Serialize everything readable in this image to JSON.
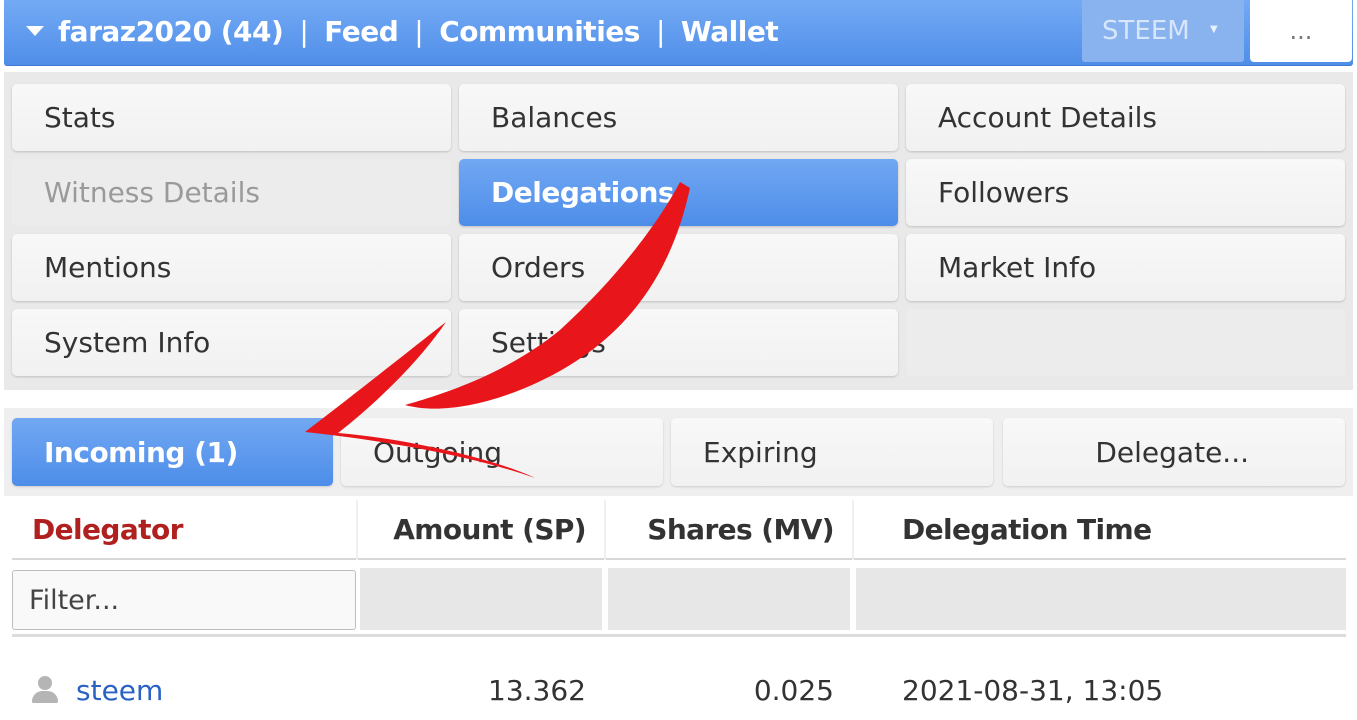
{
  "topbar": {
    "account_label": "faraz2020 (44)",
    "separator": "|",
    "links": [
      "Feed",
      "Communities",
      "Wallet"
    ],
    "chain_select": "STEEM",
    "more_label": "..."
  },
  "menu": {
    "items": [
      {
        "label": "Stats"
      },
      {
        "label": "Balances"
      },
      {
        "label": "Account Details"
      },
      {
        "label": "Witness Details",
        "state": "disabled"
      },
      {
        "label": "Delegations",
        "state": "active"
      },
      {
        "label": "Followers"
      },
      {
        "label": "Mentions"
      },
      {
        "label": "Orders"
      },
      {
        "label": "Market Info"
      },
      {
        "label": "System Info"
      },
      {
        "label": "Settings"
      }
    ]
  },
  "tabs": {
    "items": [
      {
        "label": "Incoming (1)",
        "state": "active"
      },
      {
        "label": "Outgoing"
      },
      {
        "label": "Expiring"
      },
      {
        "label": "Delegate..."
      }
    ]
  },
  "table": {
    "headers": [
      "Delegator",
      "Amount (SP)",
      "Shares (MV)",
      "Delegation Time"
    ],
    "sorted_column": "Delegator",
    "filter_placeholder": "Filter...",
    "rows": [
      {
        "delegator": "steem",
        "amount": "13.362",
        "shares": "0.025",
        "time": "2021-08-31, 13:05"
      }
    ]
  },
  "colors": {
    "accent_blue": "#5a96ec",
    "sorted_header": "#b0201e",
    "link": "#2a62c4",
    "annotation_red": "#e8161b"
  },
  "icons": {
    "dropdown": "triangle-down-icon",
    "user": "user-icon",
    "annotation": "red-arrow-annotation"
  }
}
